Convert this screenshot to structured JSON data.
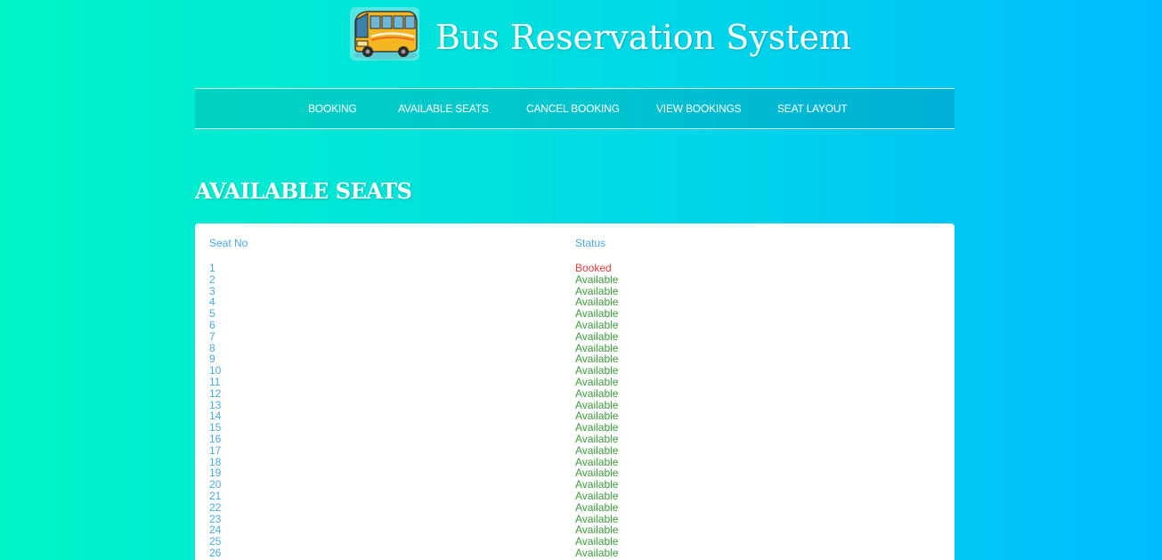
{
  "header": {
    "title": "Bus Reservation System",
    "logo_icon": "bus-icon"
  },
  "nav": {
    "items": [
      {
        "label": "BOOKING"
      },
      {
        "label": "AVAILABLE SEATS"
      },
      {
        "label": "CANCEL BOOKING"
      },
      {
        "label": "VIEW BOOKINGS"
      },
      {
        "label": "SEAT LAYOUT"
      }
    ]
  },
  "main": {
    "section_title": "AVAILABLE SEATS",
    "table": {
      "headers": {
        "seat_no": "Seat No",
        "status": "Status"
      },
      "rows": [
        {
          "seat": "1",
          "status": "Booked"
        },
        {
          "seat": "2",
          "status": "Available"
        },
        {
          "seat": "3",
          "status": "Available"
        },
        {
          "seat": "4",
          "status": "Available"
        },
        {
          "seat": "5",
          "status": "Available"
        },
        {
          "seat": "6",
          "status": "Available"
        },
        {
          "seat": "7",
          "status": "Available"
        },
        {
          "seat": "8",
          "status": "Available"
        },
        {
          "seat": "9",
          "status": "Available"
        },
        {
          "seat": "10",
          "status": "Available"
        },
        {
          "seat": "11",
          "status": "Available"
        },
        {
          "seat": "12",
          "status": "Available"
        },
        {
          "seat": "13",
          "status": "Available"
        },
        {
          "seat": "14",
          "status": "Available"
        },
        {
          "seat": "15",
          "status": "Available"
        },
        {
          "seat": "16",
          "status": "Available"
        },
        {
          "seat": "17",
          "status": "Available"
        },
        {
          "seat": "18",
          "status": "Available"
        },
        {
          "seat": "19",
          "status": "Available"
        },
        {
          "seat": "20",
          "status": "Available"
        },
        {
          "seat": "21",
          "status": "Available"
        },
        {
          "seat": "22",
          "status": "Available"
        },
        {
          "seat": "23",
          "status": "Available"
        },
        {
          "seat": "24",
          "status": "Available"
        },
        {
          "seat": "25",
          "status": "Available"
        },
        {
          "seat": "26",
          "status": "Available"
        }
      ]
    }
  },
  "colors": {
    "seat_link": "#4aa8e0",
    "available": "#3c9a3c",
    "booked": "#e23a3a"
  }
}
